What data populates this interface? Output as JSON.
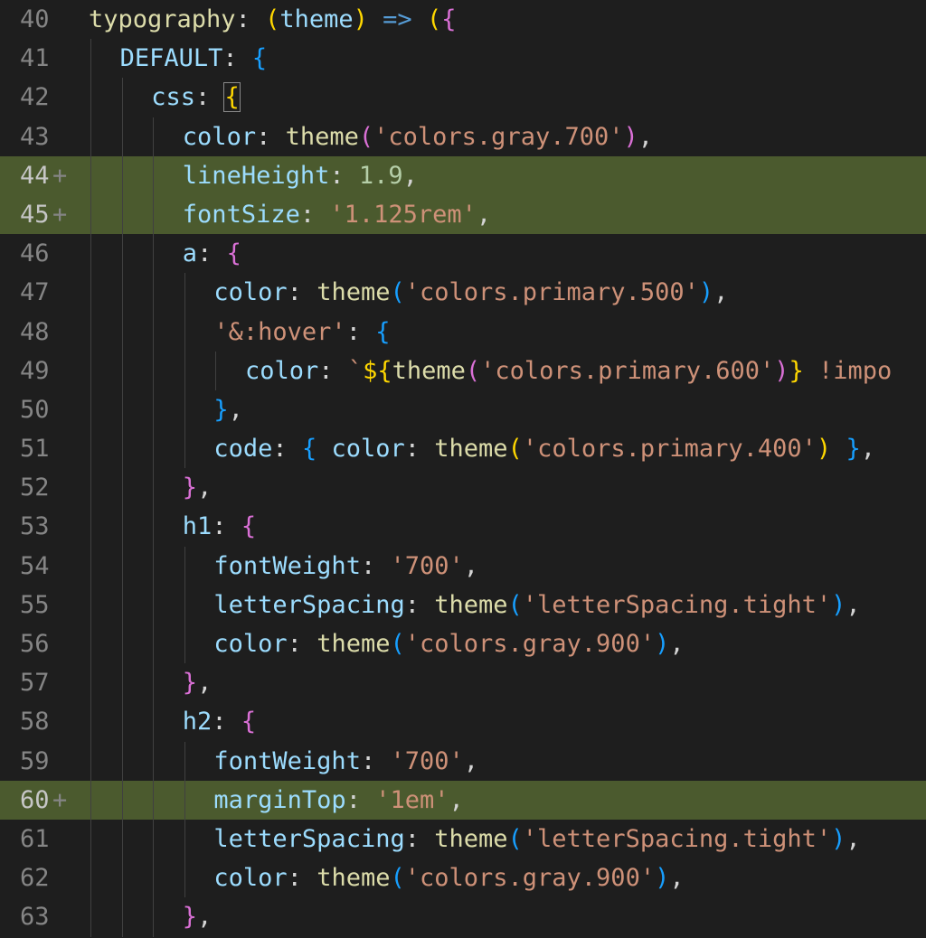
{
  "editor": {
    "colors": {
      "background": "#1e1e1e",
      "added_line": "#4b5a2e",
      "line_number": "#858585",
      "property": "#9cdcfe",
      "function": "#dcdcaa",
      "string": "#ce9178",
      "number": "#b5cea8",
      "bracket_level1": "#ffd700",
      "bracket_level2": "#da70d6",
      "bracket_level3": "#179fff"
    },
    "lines": [
      {
        "num": "40",
        "added": false,
        "indent": 0,
        "tokens": [
          {
            "t": "typography",
            "c": "func"
          },
          {
            "t": ": ",
            "c": "punc"
          },
          {
            "t": "(",
            "c": "b1"
          },
          {
            "t": "theme",
            "c": "prop"
          },
          {
            "t": ")",
            "c": "b1"
          },
          {
            "t": " ",
            "c": "punc"
          },
          {
            "t": "=>",
            "c": "kw"
          },
          {
            "t": " ",
            "c": "punc"
          },
          {
            "t": "(",
            "c": "b1"
          },
          {
            "t": "{",
            "c": "b2"
          }
        ]
      },
      {
        "num": "41",
        "added": false,
        "indent": 1,
        "tokens": [
          {
            "t": "DEFAULT",
            "c": "prop"
          },
          {
            "t": ": ",
            "c": "punc"
          },
          {
            "t": "{",
            "c": "b3"
          }
        ]
      },
      {
        "num": "42",
        "added": false,
        "indent": 2,
        "tokens": [
          {
            "t": "css",
            "c": "prop"
          },
          {
            "t": ": ",
            "c": "punc"
          },
          {
            "t": "{",
            "c": "b1",
            "box": true
          }
        ]
      },
      {
        "num": "43",
        "added": false,
        "indent": 3,
        "tokens": [
          {
            "t": "color",
            "c": "prop"
          },
          {
            "t": ": ",
            "c": "punc"
          },
          {
            "t": "theme",
            "c": "func"
          },
          {
            "t": "(",
            "c": "b2"
          },
          {
            "t": "'colors.gray.700'",
            "c": "str"
          },
          {
            "t": ")",
            "c": "b2"
          },
          {
            "t": ",",
            "c": "punc"
          }
        ]
      },
      {
        "num": "44",
        "added": true,
        "indent": 3,
        "tokens": [
          {
            "t": "lineHeight",
            "c": "prop"
          },
          {
            "t": ": ",
            "c": "punc"
          },
          {
            "t": "1.9",
            "c": "num"
          },
          {
            "t": ",",
            "c": "punc"
          }
        ]
      },
      {
        "num": "45",
        "added": true,
        "indent": 3,
        "tokens": [
          {
            "t": "fontSize",
            "c": "prop"
          },
          {
            "t": ": ",
            "c": "punc"
          },
          {
            "t": "'1.125rem'",
            "c": "str"
          },
          {
            "t": ",",
            "c": "punc"
          }
        ]
      },
      {
        "num": "46",
        "added": false,
        "indent": 3,
        "tokens": [
          {
            "t": "a",
            "c": "prop"
          },
          {
            "t": ": ",
            "c": "punc"
          },
          {
            "t": "{",
            "c": "b2"
          }
        ]
      },
      {
        "num": "47",
        "added": false,
        "indent": 4,
        "tokens": [
          {
            "t": "color",
            "c": "prop"
          },
          {
            "t": ": ",
            "c": "punc"
          },
          {
            "t": "theme",
            "c": "func"
          },
          {
            "t": "(",
            "c": "b3"
          },
          {
            "t": "'colors.primary.500'",
            "c": "str"
          },
          {
            "t": ")",
            "c": "b3"
          },
          {
            "t": ",",
            "c": "punc"
          }
        ]
      },
      {
        "num": "48",
        "added": false,
        "indent": 4,
        "tokens": [
          {
            "t": "'&:hover'",
            "c": "str"
          },
          {
            "t": ": ",
            "c": "punc"
          },
          {
            "t": "{",
            "c": "b3"
          }
        ]
      },
      {
        "num": "49",
        "added": false,
        "indent": 5,
        "tokens": [
          {
            "t": "color",
            "c": "prop"
          },
          {
            "t": ": ",
            "c": "punc"
          },
          {
            "t": "`",
            "c": "str"
          },
          {
            "t": "${",
            "c": "b1"
          },
          {
            "t": "theme",
            "c": "func"
          },
          {
            "t": "(",
            "c": "b2"
          },
          {
            "t": "'colors.primary.600'",
            "c": "str"
          },
          {
            "t": ")",
            "c": "b2"
          },
          {
            "t": "}",
            "c": "b1"
          },
          {
            "t": " !impo",
            "c": "str"
          }
        ]
      },
      {
        "num": "50",
        "added": false,
        "indent": 4,
        "tokens": [
          {
            "t": "}",
            "c": "b3"
          },
          {
            "t": ",",
            "c": "punc"
          }
        ]
      },
      {
        "num": "51",
        "added": false,
        "indent": 4,
        "tokens": [
          {
            "t": "code",
            "c": "prop"
          },
          {
            "t": ": ",
            "c": "punc"
          },
          {
            "t": "{",
            "c": "b3"
          },
          {
            "t": " ",
            "c": "punc"
          },
          {
            "t": "color",
            "c": "prop"
          },
          {
            "t": ": ",
            "c": "punc"
          },
          {
            "t": "theme",
            "c": "func"
          },
          {
            "t": "(",
            "c": "b1"
          },
          {
            "t": "'colors.primary.400'",
            "c": "str"
          },
          {
            "t": ")",
            "c": "b1"
          },
          {
            "t": " ",
            "c": "punc"
          },
          {
            "t": "}",
            "c": "b3"
          },
          {
            "t": ",",
            "c": "punc"
          }
        ]
      },
      {
        "num": "52",
        "added": false,
        "indent": 3,
        "tokens": [
          {
            "t": "}",
            "c": "b2"
          },
          {
            "t": ",",
            "c": "punc"
          }
        ]
      },
      {
        "num": "53",
        "added": false,
        "indent": 3,
        "tokens": [
          {
            "t": "h1",
            "c": "prop"
          },
          {
            "t": ": ",
            "c": "punc"
          },
          {
            "t": "{",
            "c": "b2"
          }
        ]
      },
      {
        "num": "54",
        "added": false,
        "indent": 4,
        "tokens": [
          {
            "t": "fontWeight",
            "c": "prop"
          },
          {
            "t": ": ",
            "c": "punc"
          },
          {
            "t": "'700'",
            "c": "str"
          },
          {
            "t": ",",
            "c": "punc"
          }
        ]
      },
      {
        "num": "55",
        "added": false,
        "indent": 4,
        "tokens": [
          {
            "t": "letterSpacing",
            "c": "prop"
          },
          {
            "t": ": ",
            "c": "punc"
          },
          {
            "t": "theme",
            "c": "func"
          },
          {
            "t": "(",
            "c": "b3"
          },
          {
            "t": "'letterSpacing.tight'",
            "c": "str"
          },
          {
            "t": ")",
            "c": "b3"
          },
          {
            "t": ",",
            "c": "punc"
          }
        ]
      },
      {
        "num": "56",
        "added": false,
        "indent": 4,
        "tokens": [
          {
            "t": "color",
            "c": "prop"
          },
          {
            "t": ": ",
            "c": "punc"
          },
          {
            "t": "theme",
            "c": "func"
          },
          {
            "t": "(",
            "c": "b3"
          },
          {
            "t": "'colors.gray.900'",
            "c": "str"
          },
          {
            "t": ")",
            "c": "b3"
          },
          {
            "t": ",",
            "c": "punc"
          }
        ]
      },
      {
        "num": "57",
        "added": false,
        "indent": 3,
        "tokens": [
          {
            "t": "}",
            "c": "b2"
          },
          {
            "t": ",",
            "c": "punc"
          }
        ]
      },
      {
        "num": "58",
        "added": false,
        "indent": 3,
        "tokens": [
          {
            "t": "h2",
            "c": "prop"
          },
          {
            "t": ": ",
            "c": "punc"
          },
          {
            "t": "{",
            "c": "b2"
          }
        ]
      },
      {
        "num": "59",
        "added": false,
        "indent": 4,
        "tokens": [
          {
            "t": "fontWeight",
            "c": "prop"
          },
          {
            "t": ": ",
            "c": "punc"
          },
          {
            "t": "'700'",
            "c": "str"
          },
          {
            "t": ",",
            "c": "punc"
          }
        ]
      },
      {
        "num": "60",
        "added": true,
        "indent": 4,
        "tokens": [
          {
            "t": "marginTop",
            "c": "prop"
          },
          {
            "t": ": ",
            "c": "punc"
          },
          {
            "t": "'1em'",
            "c": "str"
          },
          {
            "t": ",",
            "c": "punc"
          }
        ]
      },
      {
        "num": "61",
        "added": false,
        "indent": 4,
        "tokens": [
          {
            "t": "letterSpacing",
            "c": "prop"
          },
          {
            "t": ": ",
            "c": "punc"
          },
          {
            "t": "theme",
            "c": "func"
          },
          {
            "t": "(",
            "c": "b3"
          },
          {
            "t": "'letterSpacing.tight'",
            "c": "str"
          },
          {
            "t": ")",
            "c": "b3"
          },
          {
            "t": ",",
            "c": "punc"
          }
        ]
      },
      {
        "num": "62",
        "added": false,
        "indent": 4,
        "tokens": [
          {
            "t": "color",
            "c": "prop"
          },
          {
            "t": ": ",
            "c": "punc"
          },
          {
            "t": "theme",
            "c": "func"
          },
          {
            "t": "(",
            "c": "b3"
          },
          {
            "t": "'colors.gray.900'",
            "c": "str"
          },
          {
            "t": ")",
            "c": "b3"
          },
          {
            "t": ",",
            "c": "punc"
          }
        ]
      },
      {
        "num": "63",
        "added": false,
        "indent": 3,
        "tokens": [
          {
            "t": "}",
            "c": "b2"
          },
          {
            "t": ",",
            "c": "punc"
          }
        ]
      }
    ]
  }
}
